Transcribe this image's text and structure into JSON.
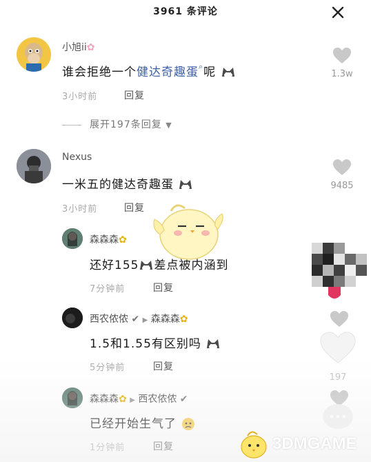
{
  "header": {
    "count": "3961",
    "suffix": "条评论"
  },
  "comments": [
    {
      "name": "小旭ii",
      "text_prefix": "谁会拒绝一个",
      "text_link": "健达奇趣蛋",
      "text_suffix": "呢",
      "time": "3小时前",
      "reply": "回复",
      "likes": "1.3w",
      "expand": "展开197条回复"
    },
    {
      "name": "Nexus",
      "text": "一米五的健达奇趣蛋",
      "time": "3小时前",
      "reply": "回复",
      "likes": "9485"
    }
  ],
  "replies": [
    {
      "name": "森森森",
      "text_prefix": "还好155",
      "text_suffix": "差点被内涵到",
      "time": "7分钟前",
      "reply": "回复"
    },
    {
      "name": "西农侬侬",
      "reply_to": "森森森",
      "text": "1.5和1.55有区别吗",
      "time": "5分钟前",
      "reply": "回复",
      "likes": "197"
    },
    {
      "name": "森森森",
      "reply_to": "西农侬侬",
      "text": "已经开始生气了",
      "time": "1分钟前",
      "reply": "回复"
    }
  ],
  "watermark": {
    "text": "3DMGAME"
  },
  "colors": {
    "link": "#3c5fa5",
    "meta": "#aaaaaa",
    "heart": "#c9c9c9"
  }
}
